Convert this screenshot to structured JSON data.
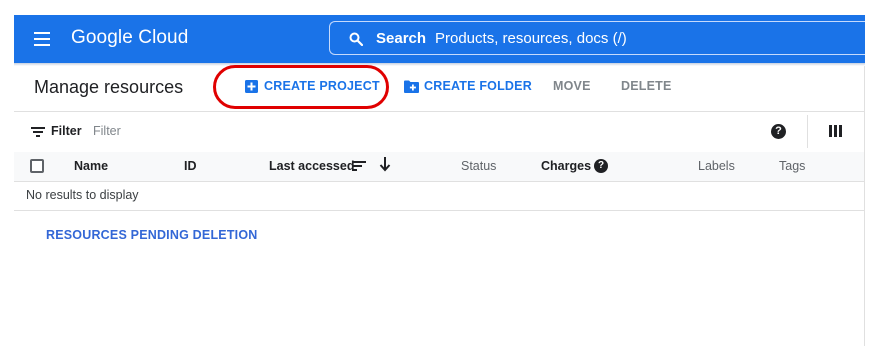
{
  "header": {
    "brand": "Google Cloud",
    "search": {
      "label": "Search",
      "hint": "Products, resources, docs (/)"
    }
  },
  "page": {
    "title": "Manage resources",
    "actions": {
      "create_project": "CREATE PROJECT",
      "create_folder": "CREATE FOLDER",
      "move": "MOVE",
      "delete": "DELETE"
    }
  },
  "filter": {
    "label": "Filter",
    "placeholder": "Filter"
  },
  "table": {
    "columns": {
      "name": "Name",
      "id": "ID",
      "last_accessed": "Last accessed",
      "status": "Status",
      "charges": "Charges",
      "labels": "Labels",
      "tags": "Tags"
    },
    "empty_message": "No results to display"
  },
  "pending_link": "RESOURCES PENDING DELETION",
  "colors": {
    "brand_blue": "#1a73e8",
    "highlight_ring": "#e00000",
    "link_blue": "#3367d6"
  },
  "icons": [
    "menu-icon",
    "search-icon",
    "add-box-icon",
    "new-folder-icon",
    "filter-icon",
    "help-icon",
    "view-columns-icon",
    "sort-icon",
    "arrow-down-icon"
  ]
}
